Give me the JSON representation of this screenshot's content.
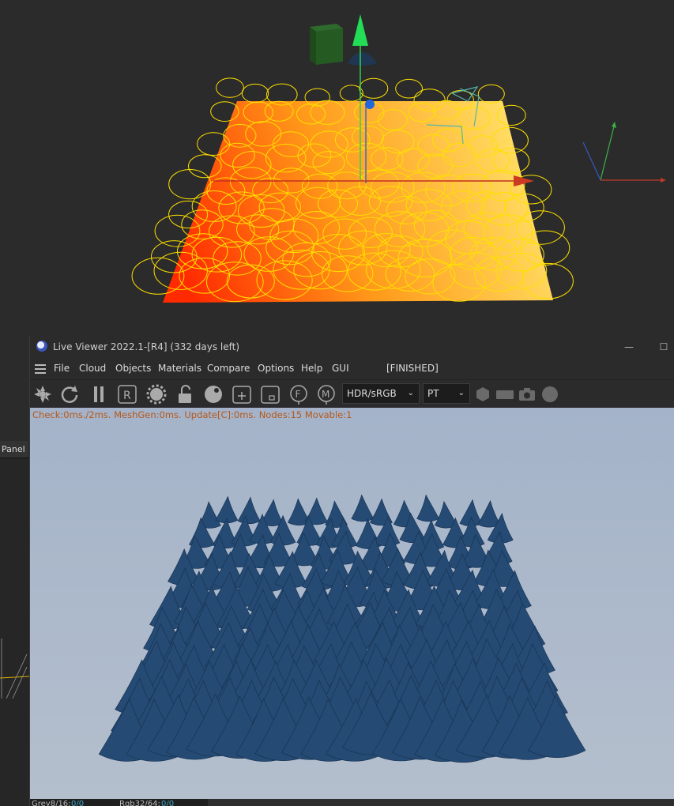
{
  "left_panel": {
    "tab_label": "Panel"
  },
  "live_viewer": {
    "title": "Live Viewer 2022.1-[R4] (332 days left)",
    "window_buttons": {
      "minimize": "—",
      "maximize": "☐"
    },
    "menu": [
      "File",
      "Cloud",
      "Objects",
      "Materials",
      "Compare",
      "Options",
      "Help",
      "GUI"
    ],
    "status_label": "[FINISHED]",
    "toolbar": {
      "icons": [
        "aperture-icon",
        "refresh-icon",
        "pause-icon",
        "region-r-icon",
        "settings-gear-icon",
        "lock-icon",
        "material-sphere-icon",
        "add-node-icon",
        "clay-icon",
        "focus-f-icon",
        "material-m-icon"
      ],
      "color_space_select": "HDR/sRGB",
      "kernel_select": "PT",
      "extra_icons": [
        "hexagon-icon",
        "film-icon",
        "camera-icon",
        "circle-icon"
      ]
    },
    "stats": "Check:0ms./2ms. MeshGen:0ms. Update[C]:0ms. Nodes:15 Movable:1",
    "status_bar": {
      "grey_label": "Grey8/16:",
      "grey_value": "0/0",
      "rgb_label": "Rgb32/64:",
      "rgb_value": "0/0"
    }
  },
  "colors": {
    "viewport_bg": "#2b2b2b",
    "render_bg": "#a7b5ca",
    "spike_color": "#254a73",
    "stats_text": "#b5581a",
    "status_value": "#3fa7c9"
  }
}
